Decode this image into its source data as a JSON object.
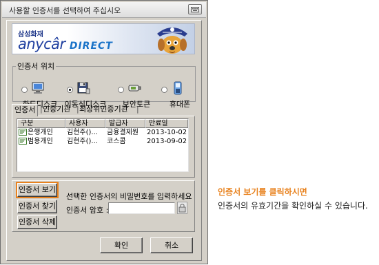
{
  "dialog": {
    "title": "사용할 인증서를 선택하여 주십시오",
    "titlebar_button_icon": "keyboard-icon"
  },
  "banner": {
    "brand_top": "삼성화재",
    "brand_main": "anycâr",
    "brand_suffix": "DIRECT",
    "mascot_icon": "pirate-dog-mascot"
  },
  "location": {
    "legend": "인증서 위치",
    "options": [
      {
        "label": "하드디스크",
        "icon": "monitor-icon",
        "selected": false
      },
      {
        "label": "이동식디스크",
        "icon": "floppy-disk-icon",
        "selected": true
      },
      {
        "label": "보안토큰",
        "icon": "security-token-icon",
        "selected": false
      },
      {
        "label": "휴대폰",
        "icon": "mobile-phone-icon",
        "selected": false
      }
    ]
  },
  "tabs": [
    "인증서",
    "인증기관",
    "최상위인증기관"
  ],
  "cert_table": {
    "columns": [
      "구분",
      "사용자",
      "발급자",
      "만료일"
    ],
    "rows": [
      {
        "type": "은행개인",
        "user": "김현주()...",
        "issuer": "금융결제원",
        "expiry": "2013-10-02"
      },
      {
        "type": "범용개인",
        "user": "김현주()...",
        "issuer": "코스콤",
        "expiry": "2013-09-02"
      }
    ]
  },
  "actions": {
    "view": "인증서 보기",
    "find": "인증서 찾기",
    "delete": "인증서 삭제"
  },
  "password": {
    "prompt": "선택한 인증서의 비밀번호를 입력하세요",
    "label": "인증서 암호 :",
    "value": ""
  },
  "footer": {
    "ok": "확인",
    "cancel": "취소"
  },
  "note": {
    "title": "인증서 보기를 클릭하시면",
    "body": "인증서의 유효기간을 확인하실 수 있습니다."
  },
  "colors": {
    "highlight": "#e8821e",
    "dialog_bg": "#d4d0c8"
  }
}
